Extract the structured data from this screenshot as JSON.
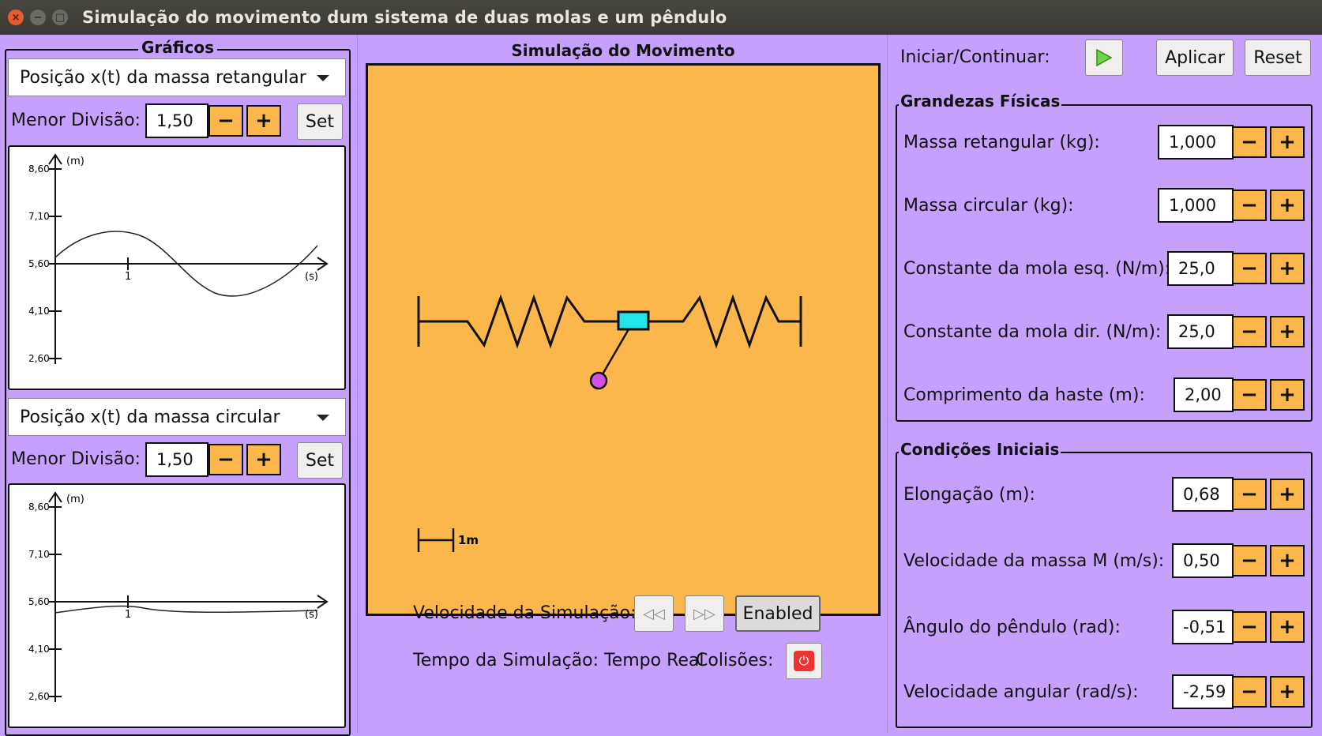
{
  "window": {
    "title": "Simulação do movimento dum sistema de duas molas e um pêndulo"
  },
  "graphs": {
    "title": "Gráficos",
    "graph1": {
      "selected": "Posição x(t) da massa retangular",
      "division_label": "Menor Divisão:",
      "division_value": "1,50",
      "set_label": "Set",
      "y_unit": "(m)",
      "x_unit": "(s)",
      "y_ticks": [
        "8,60",
        "7,10",
        "5,60",
        "4,10",
        "2,60"
      ],
      "x_tick": "1"
    },
    "graph2": {
      "selected": "Posição x(t) da massa circular",
      "division_label": "Menor Divisão:",
      "division_value": "1,50",
      "set_label": "Set",
      "y_unit": "(m)",
      "x_unit": "(s)",
      "y_ticks": [
        "8,60",
        "7,10",
        "5,60",
        "4,10",
        "2,60"
      ],
      "x_tick": "1"
    },
    "minus": "−",
    "plus": "+"
  },
  "simulation": {
    "title": "Simulação do Movimento",
    "scale_label": "1m",
    "speed_label": "Velocidade da Simulação:",
    "enabled_label": "Enabled",
    "time_label": "Tempo da Simulação: Tempo Real",
    "collisions_label": "Colisões:",
    "colors": {
      "canvas": "#fbb64c",
      "rect_mass": "#22e5ec",
      "bob": "#d24fe6"
    }
  },
  "controls": {
    "start_label": "Iniciar/Continuar:",
    "apply_label": "Aplicar",
    "reset_label": "Reset",
    "physical": {
      "title": "Grandezas Físicas",
      "rows": [
        {
          "label": "Massa retangular (kg):",
          "value": "1,000"
        },
        {
          "label": "Massa circular (kg):",
          "value": "1,000"
        },
        {
          "label": "Constante da mola esq. (N/m):",
          "value": "25,0"
        },
        {
          "label": "Constante da mola dir. (N/m):",
          "value": "25,0"
        },
        {
          "label": "Comprimento da haste (m):",
          "value": "2,00"
        }
      ]
    },
    "initial": {
      "title": "Condições Iniciais",
      "rows": [
        {
          "label": "Elongação (m):",
          "value": "0,68"
        },
        {
          "label": "Velocidade da massa M (m/s):",
          "value": "0,50"
        },
        {
          "label": "Ângulo do pêndulo (rad):",
          "value": "-0,51"
        },
        {
          "label": "Velocidade angular (rad/s):",
          "value": "-2,59"
        }
      ]
    }
  }
}
